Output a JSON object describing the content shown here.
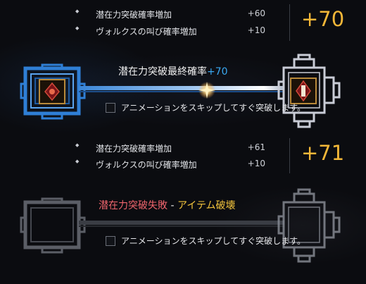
{
  "panel1": {
    "bonus_rows": [
      {
        "label": "潜在力突破確率増加",
        "value": "+60"
      },
      {
        "label": "ヴォルクスの叫び確率増加",
        "value": "+10"
      }
    ],
    "total": "+70",
    "rate_label": "潜在力突破最終確率",
    "rate_plus": "+70",
    "skip_label": "アニメーションをスキップしてすぐ突破します。"
  },
  "panel2": {
    "bonus_rows": [
      {
        "label": "潜在力突破確率増加",
        "value": "+61"
      },
      {
        "label": "ヴォルクスの叫び確率増加",
        "value": "+10"
      }
    ],
    "total": "+71",
    "fail_red": "潜在力突破失敗",
    "fail_sep": " - ",
    "fail_item": "アイテム破壊",
    "skip_label": "アニメーションをスキップしてすぐ突破します。"
  },
  "colors": {
    "total": "#f3b738",
    "rate_plus": "#3aa9f2",
    "fail_red": "#f0656d",
    "fail_item": "#f2c33c",
    "key_blue": "#2f7fd6",
    "key_silver": "#c9ccd6"
  }
}
